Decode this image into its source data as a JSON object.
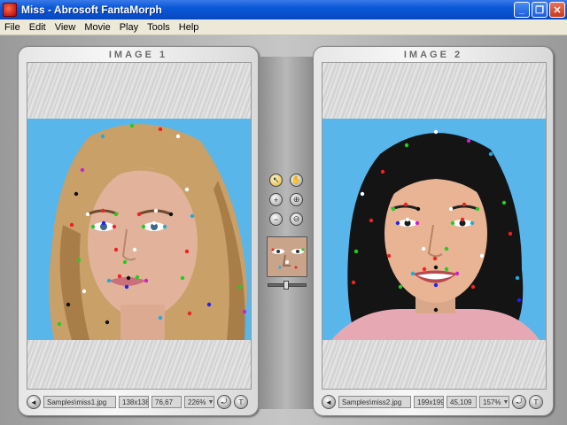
{
  "window": {
    "title": "Miss - Abrosoft FantaMorph"
  },
  "menu": [
    "File",
    "Edit",
    "View",
    "Movie",
    "Play",
    "Tools",
    "Help"
  ],
  "window_buttons": {
    "minimize": "_",
    "maximize": "❐",
    "close": "✕"
  },
  "panels": {
    "left": {
      "title": "IMAGE 1",
      "file": "Samples\\miss1.jpg",
      "size": "138x138",
      "coords": "76,67",
      "zoom": "226%"
    },
    "right": {
      "title": "IMAGE 2",
      "file": "Samples\\miss2.jpg",
      "size": "199x199",
      "coords": "45,109",
      "zoom": "157%"
    }
  },
  "tools": {
    "select": "↖",
    "pan": "✋",
    "add": "+",
    "zoom_in": "⊕",
    "remove": "−",
    "zoom_out": "⊖"
  },
  "status_icons": {
    "menu": "◄",
    "fit": "⤾",
    "text": "T"
  },
  "preview_slider": {
    "position": 0.45
  },
  "colors": {
    "sky": "#58b6ea",
    "accent_titlebar": "#0a58d8"
  }
}
